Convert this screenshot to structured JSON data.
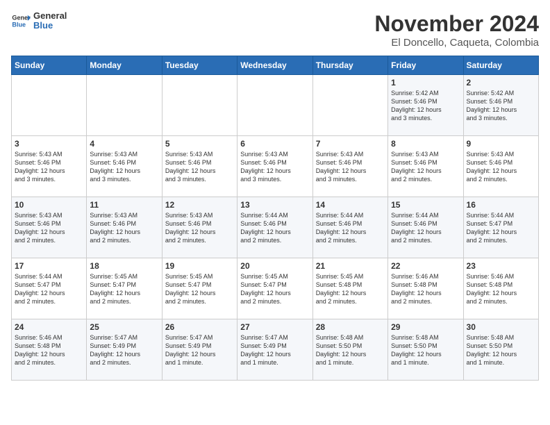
{
  "logo": {
    "line1": "General",
    "line2": "Blue"
  },
  "title": "November 2024",
  "location": "El Doncello, Caqueta, Colombia",
  "weekdays": [
    "Sunday",
    "Monday",
    "Tuesday",
    "Wednesday",
    "Thursday",
    "Friday",
    "Saturday"
  ],
  "weeks": [
    [
      {
        "day": "",
        "info": ""
      },
      {
        "day": "",
        "info": ""
      },
      {
        "day": "",
        "info": ""
      },
      {
        "day": "",
        "info": ""
      },
      {
        "day": "",
        "info": ""
      },
      {
        "day": "1",
        "info": "Sunrise: 5:42 AM\nSunset: 5:46 PM\nDaylight: 12 hours\nand 3 minutes."
      },
      {
        "day": "2",
        "info": "Sunrise: 5:42 AM\nSunset: 5:46 PM\nDaylight: 12 hours\nand 3 minutes."
      }
    ],
    [
      {
        "day": "3",
        "info": "Sunrise: 5:43 AM\nSunset: 5:46 PM\nDaylight: 12 hours\nand 3 minutes."
      },
      {
        "day": "4",
        "info": "Sunrise: 5:43 AM\nSunset: 5:46 PM\nDaylight: 12 hours\nand 3 minutes."
      },
      {
        "day": "5",
        "info": "Sunrise: 5:43 AM\nSunset: 5:46 PM\nDaylight: 12 hours\nand 3 minutes."
      },
      {
        "day": "6",
        "info": "Sunrise: 5:43 AM\nSunset: 5:46 PM\nDaylight: 12 hours\nand 3 minutes."
      },
      {
        "day": "7",
        "info": "Sunrise: 5:43 AM\nSunset: 5:46 PM\nDaylight: 12 hours\nand 3 minutes."
      },
      {
        "day": "8",
        "info": "Sunrise: 5:43 AM\nSunset: 5:46 PM\nDaylight: 12 hours\nand 2 minutes."
      },
      {
        "day": "9",
        "info": "Sunrise: 5:43 AM\nSunset: 5:46 PM\nDaylight: 12 hours\nand 2 minutes."
      }
    ],
    [
      {
        "day": "10",
        "info": "Sunrise: 5:43 AM\nSunset: 5:46 PM\nDaylight: 12 hours\nand 2 minutes."
      },
      {
        "day": "11",
        "info": "Sunrise: 5:43 AM\nSunset: 5:46 PM\nDaylight: 12 hours\nand 2 minutes."
      },
      {
        "day": "12",
        "info": "Sunrise: 5:43 AM\nSunset: 5:46 PM\nDaylight: 12 hours\nand 2 minutes."
      },
      {
        "day": "13",
        "info": "Sunrise: 5:44 AM\nSunset: 5:46 PM\nDaylight: 12 hours\nand 2 minutes."
      },
      {
        "day": "14",
        "info": "Sunrise: 5:44 AM\nSunset: 5:46 PM\nDaylight: 12 hours\nand 2 minutes."
      },
      {
        "day": "15",
        "info": "Sunrise: 5:44 AM\nSunset: 5:46 PM\nDaylight: 12 hours\nand 2 minutes."
      },
      {
        "day": "16",
        "info": "Sunrise: 5:44 AM\nSunset: 5:47 PM\nDaylight: 12 hours\nand 2 minutes."
      }
    ],
    [
      {
        "day": "17",
        "info": "Sunrise: 5:44 AM\nSunset: 5:47 PM\nDaylight: 12 hours\nand 2 minutes."
      },
      {
        "day": "18",
        "info": "Sunrise: 5:45 AM\nSunset: 5:47 PM\nDaylight: 12 hours\nand 2 minutes."
      },
      {
        "day": "19",
        "info": "Sunrise: 5:45 AM\nSunset: 5:47 PM\nDaylight: 12 hours\nand 2 minutes."
      },
      {
        "day": "20",
        "info": "Sunrise: 5:45 AM\nSunset: 5:47 PM\nDaylight: 12 hours\nand 2 minutes."
      },
      {
        "day": "21",
        "info": "Sunrise: 5:45 AM\nSunset: 5:48 PM\nDaylight: 12 hours\nand 2 minutes."
      },
      {
        "day": "22",
        "info": "Sunrise: 5:46 AM\nSunset: 5:48 PM\nDaylight: 12 hours\nand 2 minutes."
      },
      {
        "day": "23",
        "info": "Sunrise: 5:46 AM\nSunset: 5:48 PM\nDaylight: 12 hours\nand 2 minutes."
      }
    ],
    [
      {
        "day": "24",
        "info": "Sunrise: 5:46 AM\nSunset: 5:48 PM\nDaylight: 12 hours\nand 2 minutes."
      },
      {
        "day": "25",
        "info": "Sunrise: 5:47 AM\nSunset: 5:49 PM\nDaylight: 12 hours\nand 2 minutes."
      },
      {
        "day": "26",
        "info": "Sunrise: 5:47 AM\nSunset: 5:49 PM\nDaylight: 12 hours\nand 1 minute."
      },
      {
        "day": "27",
        "info": "Sunrise: 5:47 AM\nSunset: 5:49 PM\nDaylight: 12 hours\nand 1 minute."
      },
      {
        "day": "28",
        "info": "Sunrise: 5:48 AM\nSunset: 5:50 PM\nDaylight: 12 hours\nand 1 minute."
      },
      {
        "day": "29",
        "info": "Sunrise: 5:48 AM\nSunset: 5:50 PM\nDaylight: 12 hours\nand 1 minute."
      },
      {
        "day": "30",
        "info": "Sunrise: 5:48 AM\nSunset: 5:50 PM\nDaylight: 12 hours\nand 1 minute."
      }
    ]
  ]
}
